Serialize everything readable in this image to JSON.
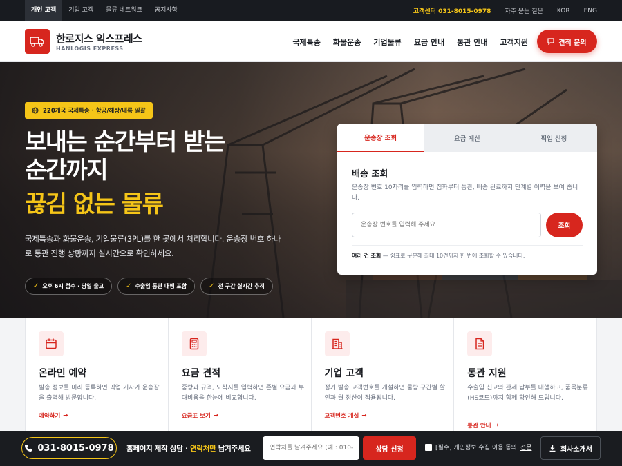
{
  "topbar": {
    "tabs": [
      {
        "label": "개인 고객",
        "active": true
      },
      {
        "label": "기업 고객",
        "active": false
      },
      {
        "label": "물류 네트워크",
        "active": false
      },
      {
        "label": "공지사항",
        "active": false
      }
    ],
    "hotline": "고객센터 031-8015-0978",
    "faq": "자주 묻는 질문",
    "lang_kor": "KOR",
    "lang_eng": "ENG"
  },
  "header": {
    "logo_ko": "한로지스 익스프레스",
    "logo_en": "HANLOGIS EXPRESS",
    "nav": [
      "국제특송",
      "화물운송",
      "기업물류",
      "요금 안내",
      "통관 안내",
      "고객지원"
    ],
    "quote_label": "견적 문의"
  },
  "hero": {
    "badge": "220개국 국제특송 · 항공/해상/내륙 일괄",
    "headline_1": "보내는 순간부터 받는",
    "headline_2": "순간까지",
    "headline_3": "끊김 없는 물류",
    "description": "국제특송과 화물운송, 기업물류(3PL)를 한 곳에서 처리합니다. 운송장 번호 하나로 통관 진행 상황까지 실시간으로 확인하세요.",
    "chips": [
      "오후 6시 접수 · 당일 출고",
      "수출입 통관 대행 포함",
      "전 구간 실시간 추적"
    ]
  },
  "tracking": {
    "tabs": [
      {
        "label": "운송장 조회",
        "active": true
      },
      {
        "label": "요금 계산",
        "active": false
      },
      {
        "label": "픽업 신청",
        "active": false
      }
    ],
    "title": "배송 조회",
    "subtitle": "운송장 번호 10자리를 입력하면 집화부터 통관, 배송 완료까지 단계별 이력을 보여 줍니다.",
    "input_placeholder": "운송장 번호를 입력해 주세요",
    "submit_label": "조회",
    "note_bold": "여러 건 조회",
    "note_text": " — 쉼표로 구분해 최대 10건까지 한 번에 조회할 수 있습니다."
  },
  "services": [
    {
      "icon": "calendar-icon",
      "title": "온라인 예약",
      "desc": "발송 정보를 미리 등록하면 픽업 기사가 운송장을 출력해 방문합니다.",
      "link": "예약하기"
    },
    {
      "icon": "calculator-icon",
      "title": "요금 견적",
      "desc": "중량과 규격, 도착지를 입력하면 존별 요금과 부대비용을 한눈에 비교합니다.",
      "link": "요금표 보기"
    },
    {
      "icon": "building-icon",
      "title": "기업 고객",
      "desc": "정기 발송 고객번호를 개설하면 물량 구간별 할인과 월 정산이 적용됩니다.",
      "link": "고객번호 개설"
    },
    {
      "icon": "document-icon",
      "title": "통관 지원",
      "desc": "수출입 신고와 관세 납부를 대행하고, 품목분류(HS코드)까지 함께 확인해 드립니다.",
      "link": "통관 안내"
    }
  ],
  "bottombar": {
    "phone": "031-8015-0978",
    "msg_prefix": "홈페이지 제작 상담 · ",
    "msg_highlight": "연락처만",
    "msg_suffix": " 남겨주세요",
    "input_placeholder": "연락처를 남겨주세요 (예 : 010-",
    "submit_label": "상담 신청",
    "agree_text": "[필수] 개인정보 수집·이용 동의",
    "agree_link": "전문",
    "file_label": "회사소개서"
  },
  "colors": {
    "accent": "#d7261e",
    "highlight": "#f5c518",
    "dark": "#181b20"
  }
}
